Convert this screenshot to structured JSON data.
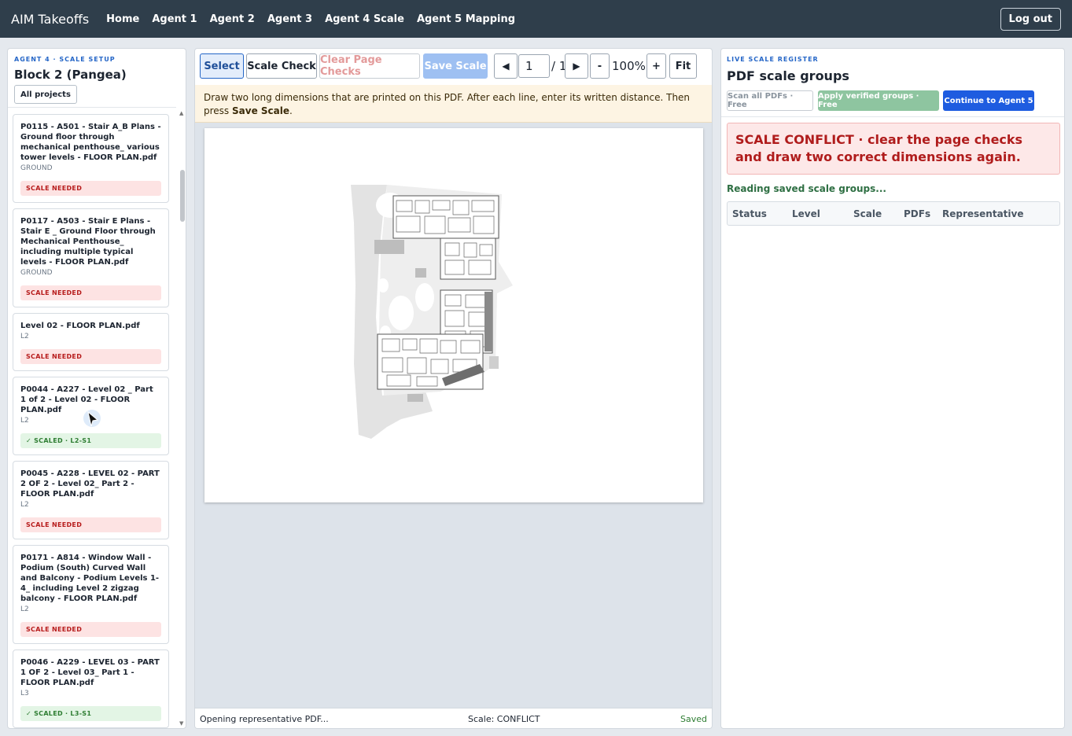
{
  "nav": {
    "brand": "AIM Takeoffs",
    "links": [
      "Home",
      "Agent 1",
      "Agent 2",
      "Agent 3",
      "Agent 4 Scale",
      "Agent 5 Mapping"
    ],
    "logout": "Log out"
  },
  "left": {
    "eyebrow": "AGENT 4 · SCALE SETUP",
    "title": "Block 2 (Pangea)",
    "all_projects": "All projects",
    "cards": [
      {
        "title": "P0115 - A501 - Stair A_B Plans - Ground floor through mechanical penthouse_ various tower levels - FLOOR PLAN.pdf",
        "level": "GROUND",
        "badge": "SCALE NEEDED",
        "status": "needed"
      },
      {
        "title": "P0117 - A503 - Stair E Plans - Stair E _ Ground Floor through Mechanical Penthouse_ including multiple typical levels - FLOOR PLAN.pdf",
        "level": "GROUND",
        "badge": "SCALE NEEDED",
        "status": "needed"
      },
      {
        "title": "Level 02 - FLOOR PLAN.pdf",
        "level": "L2",
        "badge": "SCALE NEEDED",
        "status": "needed"
      },
      {
        "title": "P0044 - A227 - Level 02 _ Part 1 of 2 - Level 02 - FLOOR PLAN.pdf",
        "level": "L2",
        "badge": "✓ SCALED · L2-S1",
        "status": "scaled"
      },
      {
        "title": "P0045 - A228 - LEVEL 02 - PART 2 OF 2 - Level 02_ Part 2 - FLOOR PLAN.pdf",
        "level": "L2",
        "badge": "SCALE NEEDED",
        "status": "needed"
      },
      {
        "title": "P0171 - A814 - Window Wall - Podium (South) Curved Wall and Balcony - Podium Levels 1-4_ including Level 2 zigzag balcony - FLOOR PLAN.pdf",
        "level": "L2",
        "badge": "SCALE NEEDED",
        "status": "needed"
      },
      {
        "title": "P0046 - A229 - LEVEL 03 - PART 1 OF 2 - Level 03_ Part 1 - FLOOR PLAN.pdf",
        "level": "L3",
        "badge": "✓ SCALED · L3-S1",
        "status": "scaled"
      }
    ]
  },
  "toolbar": {
    "select": "Select",
    "scale_check": "Scale Check",
    "clear": "Clear Page Checks",
    "save": "Save Scale",
    "prev": "◀",
    "page": "1",
    "total": "/ 1",
    "next": "▶",
    "zoom_out": "-",
    "zoom": "100%",
    "zoom_in": "+",
    "fit": "Fit"
  },
  "notice": {
    "text": "Draw two long dimensions that are printed on this PDF. After each line, enter its written distance. Then press ",
    "bold": "Save Scale",
    "end": "."
  },
  "status": {
    "left": "Opening representative PDF...",
    "mid": "Scale: CONFLICT",
    "right": "Saved"
  },
  "right": {
    "eyebrow": "LIVE SCALE REGISTER",
    "title": "PDF scale groups",
    "scan": "Scan all PDFs · Free",
    "apply": "Apply verified groups · Free",
    "continue": "Continue to Agent 5",
    "conflict": "SCALE CONFLICT · clear the page checks and draw two correct dimensions again.",
    "reading": "Reading saved scale groups...",
    "columns": [
      "Status",
      "Level",
      "Scale",
      "PDFs",
      "Representative"
    ]
  }
}
